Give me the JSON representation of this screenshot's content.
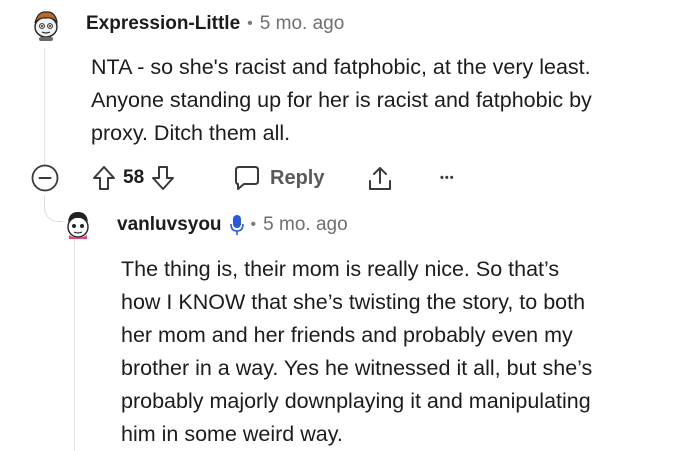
{
  "comment": {
    "username": "Expression-Little",
    "separator": "•",
    "timestamp": "5 mo. ago",
    "body_lines": [
      "NTA - so she's racist and fatphobic, at the very least.",
      "Anyone standing up for her is racist and fatphobic by",
      "proxy. Ditch them all."
    ],
    "votes": "58",
    "reply_label": "Reply",
    "more_label": "•••"
  },
  "reply": {
    "username": "vanluvsyou",
    "separator": "•",
    "timestamp": "5 mo. ago",
    "body_lines": [
      "The thing is, their mom is really nice. So that’s",
      "how I KNOW that she’s twisting the story, to both",
      "her mom and her friends and probably even my",
      "brother in a way. Yes he witnessed it all, but she’s",
      "probably majorly downplaying it and manipulating",
      "him in some weird way."
    ]
  },
  "colors": {
    "text": "#1c1c1c",
    "meta": "#6f6f6f",
    "mic_badge": "#2a5bd7",
    "thread_line": "#e2e2e2"
  }
}
